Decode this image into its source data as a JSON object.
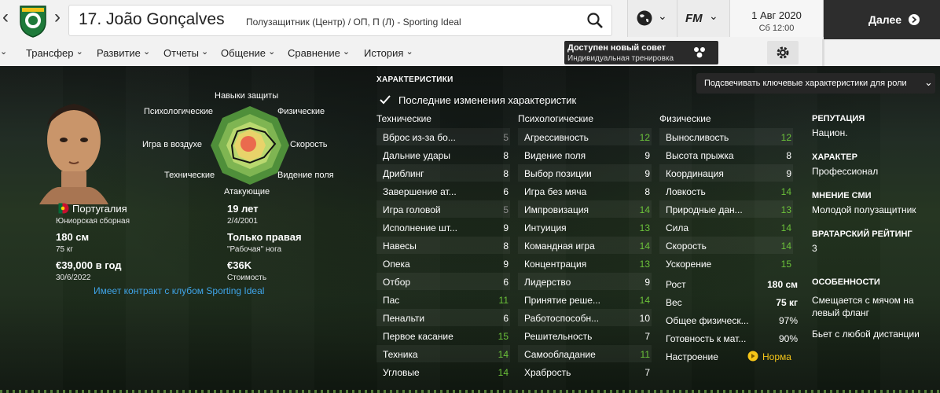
{
  "header": {
    "player_title": "17. João Gonçalves",
    "role_line": "Полузащитник (Центр) / ОП, П (Л) - Sporting Ideal",
    "date": "1 Авг 2020",
    "day_time": "Сб 12:00",
    "continue_label": "Далее",
    "fm_label": "FM"
  },
  "menu": [
    "Трансфер",
    "Развитие",
    "Отчеты",
    "Общение",
    "Сравнение",
    "История"
  ],
  "advice": {
    "title": "Доступен новый совет",
    "subtitle": "Индивидуальная тренировка"
  },
  "profile": {
    "nation": "Португалия",
    "nation_team": "Юниорская сборная",
    "age": "19 лет",
    "birth": "2/4/2001",
    "height": "180 см",
    "weight": "75 кг",
    "foot": "Только правая",
    "foot_label": "\"Рабочая\" нога",
    "wage": "€39,000 в год",
    "contract_end": "30/6/2022",
    "value": "€36K",
    "value_label": "Стоимость",
    "contract_note": "Имеет контракт с клубом Sporting Ideal"
  },
  "radar": {
    "top": "Навыки защиты",
    "top_left": "Психологические",
    "top_right": "Физические",
    "left": "Игра в воздухе",
    "right": "Скорость",
    "bottom_left": "Технические",
    "bottom_right": "Видение поля",
    "bottom": "Атакующие"
  },
  "attributes": {
    "title": "ХАРАКТЕРИСТИКИ",
    "recent_changes": "Последние изменения характеристик",
    "highlight_dropdown": "Подсвечивать ключевые характеристики для роли",
    "technical_header": "Технические",
    "mental_header": "Психологические",
    "physical_header": "Физические",
    "technical": [
      {
        "name": "Вброс из-за бо...",
        "value": "5"
      },
      {
        "name": "Дальние удары",
        "value": "8"
      },
      {
        "name": "Дриблинг",
        "value": "8"
      },
      {
        "name": "Завершение ат...",
        "value": "6"
      },
      {
        "name": "Игра головой",
        "value": "5"
      },
      {
        "name": "Исполнение шт...",
        "value": "9"
      },
      {
        "name": "Навесы",
        "value": "8"
      },
      {
        "name": "Опека",
        "value": "9"
      },
      {
        "name": "Отбор",
        "value": "6"
      },
      {
        "name": "Пас",
        "value": "11"
      },
      {
        "name": "Пенальти",
        "value": "6"
      },
      {
        "name": "Первое касание",
        "value": "15"
      },
      {
        "name": "Техника",
        "value": "14"
      },
      {
        "name": "Угловые",
        "value": "14"
      }
    ],
    "mental": [
      {
        "name": "Агрессивность",
        "value": "12"
      },
      {
        "name": "Видение поля",
        "value": "9"
      },
      {
        "name": "Выбор позиции",
        "value": "9"
      },
      {
        "name": "Игра без мяча",
        "value": "8"
      },
      {
        "name": "Импровизация",
        "value": "14"
      },
      {
        "name": "Интуиция",
        "value": "13"
      },
      {
        "name": "Командная игра",
        "value": "14"
      },
      {
        "name": "Концентрация",
        "value": "13"
      },
      {
        "name": "Лидерство",
        "value": "9"
      },
      {
        "name": "Принятие реше...",
        "value": "14"
      },
      {
        "name": "Работоспособн...",
        "value": "10"
      },
      {
        "name": "Решительность",
        "value": "7"
      },
      {
        "name": "Самообладание",
        "value": "11"
      },
      {
        "name": "Храбрость",
        "value": "7"
      }
    ],
    "physical": [
      {
        "name": "Выносливость",
        "value": "12"
      },
      {
        "name": "Высота прыжка",
        "value": "8"
      },
      {
        "name": "Координация",
        "value": "9"
      },
      {
        "name": "Ловкость",
        "value": "14"
      },
      {
        "name": "Природные дан...",
        "value": "13"
      },
      {
        "name": "Сила",
        "value": "14"
      },
      {
        "name": "Скорость",
        "value": "14"
      },
      {
        "name": "Ускорение",
        "value": "15"
      }
    ],
    "extra": [
      {
        "name": "Рост",
        "value": "180 см"
      },
      {
        "name": "Вес",
        "value": "75 кг"
      },
      {
        "name": "Общее физическ...",
        "value": "97%"
      },
      {
        "name": "Готовность к мат...",
        "value": "90%"
      }
    ],
    "mood_label": "Настроение",
    "mood_value": "Норма"
  },
  "side": {
    "reputation_label": "РЕПУТАЦИЯ",
    "reputation": "Национ.",
    "character_label": "ХАРАКТЕР",
    "character": "Профессионал",
    "media_label": "МНЕНИЕ СМИ",
    "media": "Молодой полузащитник",
    "gk_label": "ВРАТАРСКИЙ РЕЙТИНГ",
    "gk": "3",
    "traits_label": "ОСОБЕННОСТИ",
    "traits": [
      "Смещается с мячом на левый фланг",
      "Бьет с любой дистанции"
    ]
  },
  "colors": {
    "high": "#6cc33a",
    "mid": "#ffffff",
    "low": "#8d8d8d",
    "link": "#3fa4e8",
    "mood": "#f5c518"
  }
}
